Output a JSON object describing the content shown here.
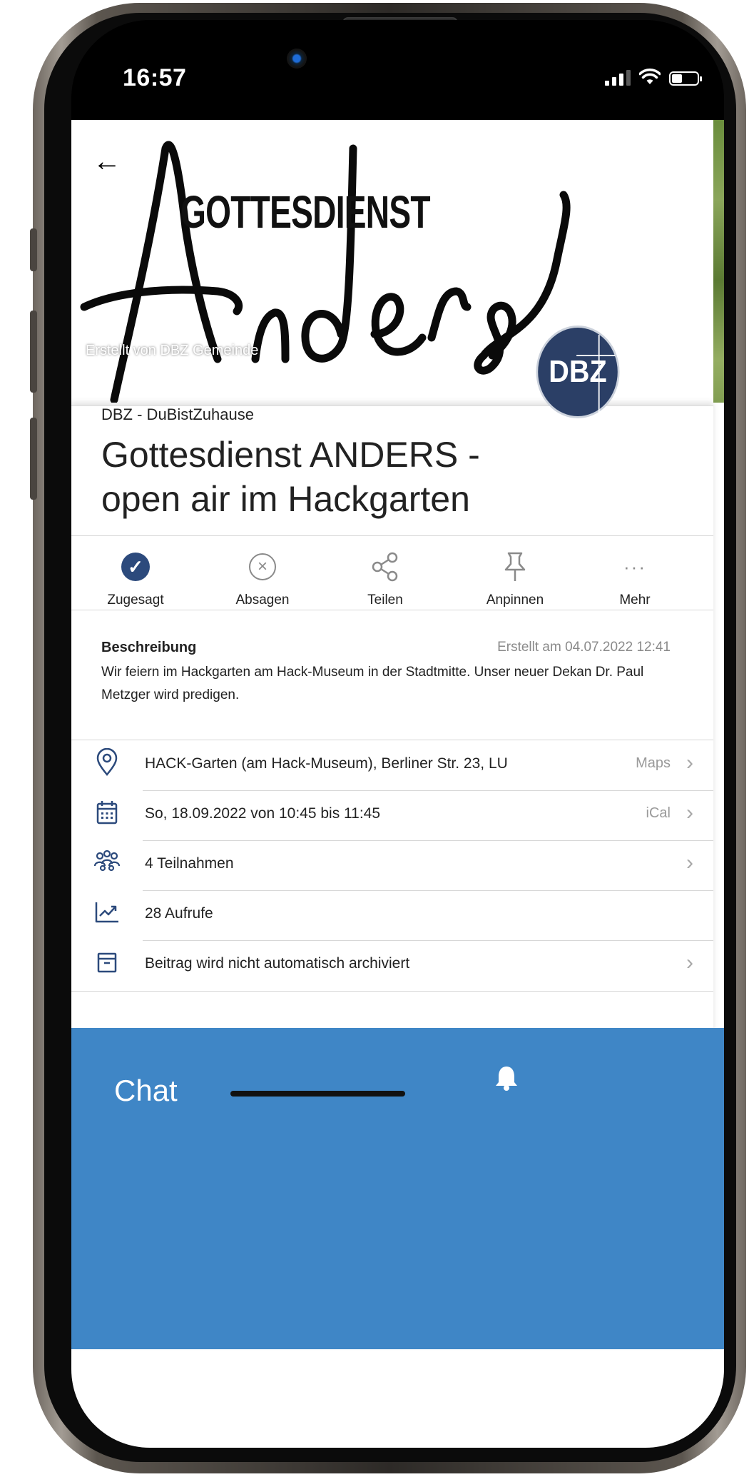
{
  "status_bar": {
    "time": "16:57"
  },
  "hero": {
    "word_upper": "GOTTESDIENST",
    "word_script": "Anders",
    "credit": "Erstellt von DBZ Gemeinde"
  },
  "logo": {
    "text": "DBZ"
  },
  "post": {
    "group": "DBZ - DuBistZuhause",
    "title": "Gottesdienst ANDERS - open air im Hackgarten"
  },
  "actions": [
    {
      "label": "Zugesagt",
      "icon": "check-circle-icon",
      "active": true
    },
    {
      "label": "Absagen",
      "icon": "x-circle-icon"
    },
    {
      "label": "Teilen",
      "icon": "share-icon"
    },
    {
      "label": "Anpinnen",
      "icon": "pin-icon"
    },
    {
      "label": "Mehr",
      "icon": "more-icon"
    }
  ],
  "description": {
    "label": "Beschreibung",
    "created": "Erstellt am 04.07.2022 12:41",
    "text": "Wir feiern im Hackgarten am Hack-Museum in der Stadtmitte. Unser neuer Dekan Dr. Paul Metzger wird predigen."
  },
  "info": [
    {
      "icon": "location-pin-icon",
      "text": "HACK-Garten (am Hack-Museum), Berliner Str. 23, LU",
      "side": "Maps",
      "chevron": true
    },
    {
      "icon": "calendar-icon",
      "text": "So, 18.09.2022 von 10:45 bis 11:45",
      "side": "iCal",
      "chevron": true
    },
    {
      "icon": "people-icon",
      "text": "4 Teilnahmen",
      "side": "",
      "chevron": true
    },
    {
      "icon": "trending-chart-icon",
      "text": "28 Aufrufe",
      "side": "",
      "chevron": false
    },
    {
      "icon": "archive-icon",
      "text": "Beitrag wird nicht automatisch archiviert",
      "side": "",
      "chevron": true
    }
  ],
  "bottom": {
    "chat": "Chat"
  },
  "colors": {
    "accent": "#2c4a7c",
    "bottom_bar": "#3f86c6",
    "logo_bg": "#2b3f66"
  }
}
